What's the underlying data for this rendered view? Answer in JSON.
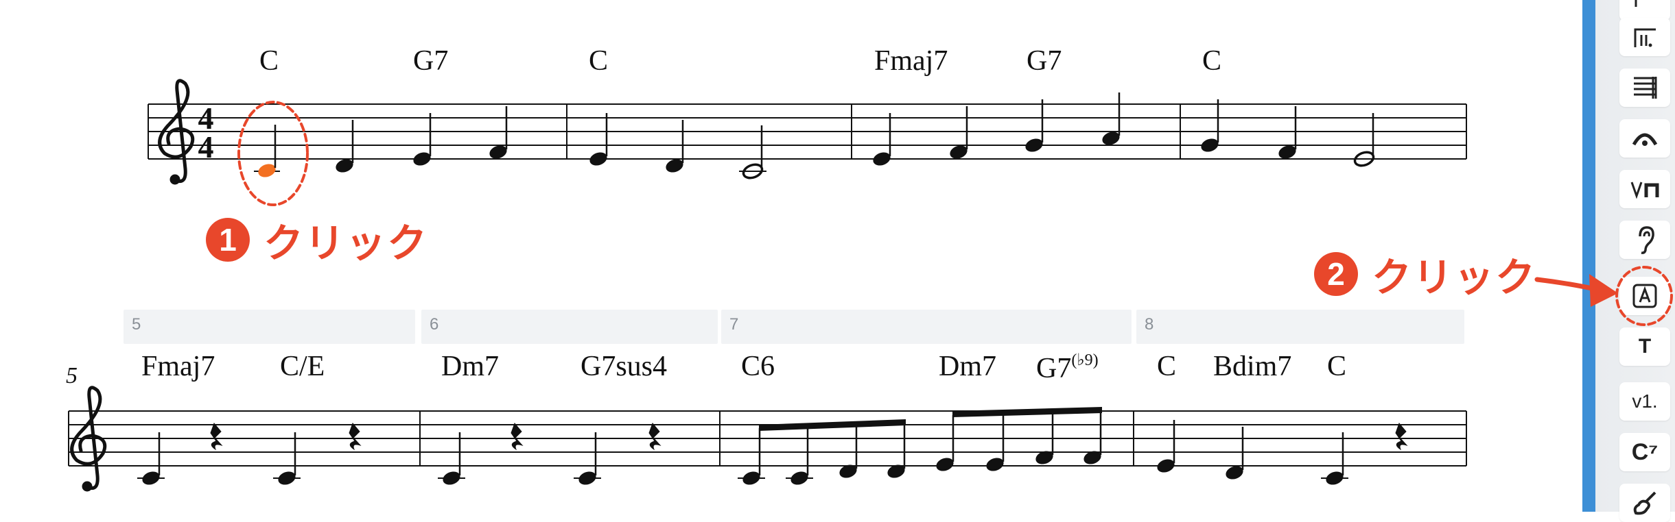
{
  "score": {
    "system1_chords": [
      "C",
      "G7",
      "C",
      "Fmaj7",
      "G7",
      "C"
    ],
    "system2_chords": [
      "Fmaj7",
      "C/E",
      "Dm7",
      "G7sus4",
      "C6",
      "Dm7",
      "G7",
      "C",
      "Bdim7",
      "C"
    ],
    "g7_superscript": "(♭9)",
    "time_signature_top": "4",
    "time_signature_bottom": "4",
    "system2_number": "5",
    "measure_headers": [
      "5",
      "6",
      "7",
      "8"
    ]
  },
  "annotations": {
    "step1_number": "1",
    "step1_text": "クリック",
    "step2_number": "2",
    "step2_text": "クリック",
    "color": "#e8472b"
  },
  "toolbar": {
    "items": [
      {
        "icon": "repeat-bar-icon"
      },
      {
        "icon": "multi-rest-icon"
      },
      {
        "icon": "fermata-icon"
      },
      {
        "icon": "bowing-icon"
      },
      {
        "icon": "ear-icon"
      },
      {
        "icon": "rehearsal-mark-icon"
      },
      {
        "icon": "text-icon",
        "label": "T"
      },
      {
        "icon": "volta-icon",
        "label": "v1."
      },
      {
        "icon": "chord-symbol-icon",
        "label": "C⁷"
      },
      {
        "icon": "guitar-icon"
      }
    ],
    "accent": "#3d8fd6"
  }
}
